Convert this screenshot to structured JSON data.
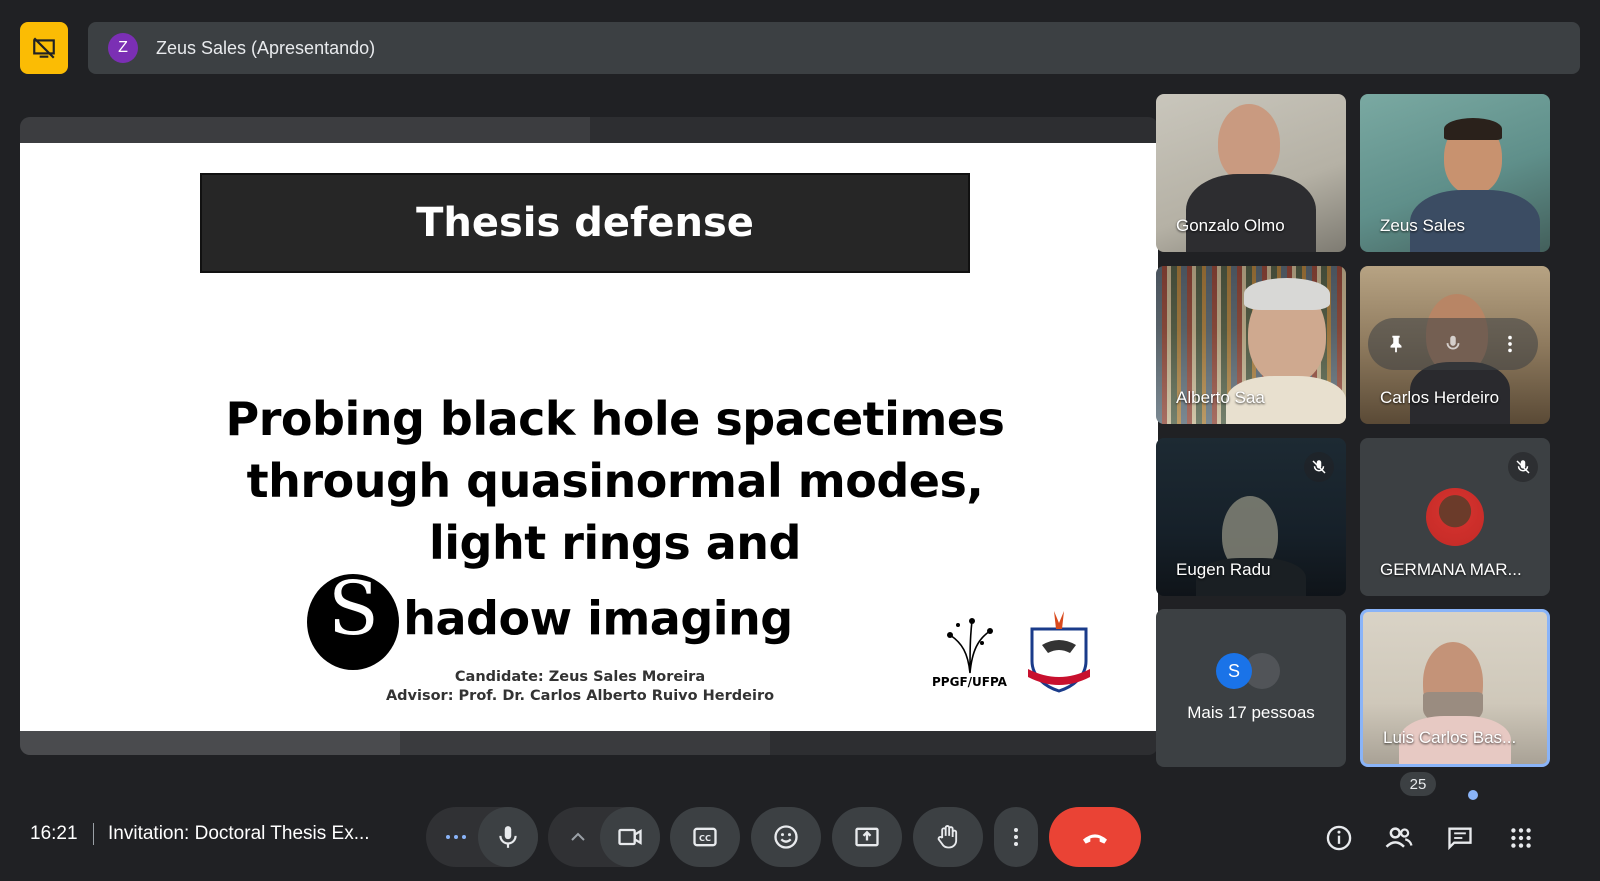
{
  "top": {
    "presenter_initial": "Z",
    "presenter_label": "Zeus Sales (Apresentando)"
  },
  "slide": {
    "title": "Thesis defense",
    "line1": "Probing black hole spacetimes",
    "line2": "through quasinormal modes,",
    "line3": "light rings and",
    "line4": "hadow imaging",
    "candidate": "Candidate: Zeus Sales Moreira",
    "advisor": "Advisor: Prof. Dr. Carlos Alberto Ruivo Herdeiro",
    "logo_text": "PPGF/UFPA"
  },
  "participants": [
    {
      "name": "Gonzalo Olmo"
    },
    {
      "name": "Zeus Sales"
    },
    {
      "name": "Alberto Saa"
    },
    {
      "name": "Carlos Herdeiro"
    },
    {
      "name": "Eugen Radu"
    },
    {
      "name": "GERMANA MAR..."
    },
    {
      "name": "Mais 17 pessoas",
      "initial": "S"
    },
    {
      "name": "Luis Carlos Bas..."
    }
  ],
  "bottom": {
    "time": "16:21",
    "meeting_title": "Invitation: Doctoral Thesis Ex...",
    "people_count": "25"
  },
  "colors": {
    "background": "#202124",
    "tile": "#3c4043",
    "accent_yellow": "#fbbc04",
    "end_call": "#ea4335",
    "active_border": "#8ab4f8"
  }
}
